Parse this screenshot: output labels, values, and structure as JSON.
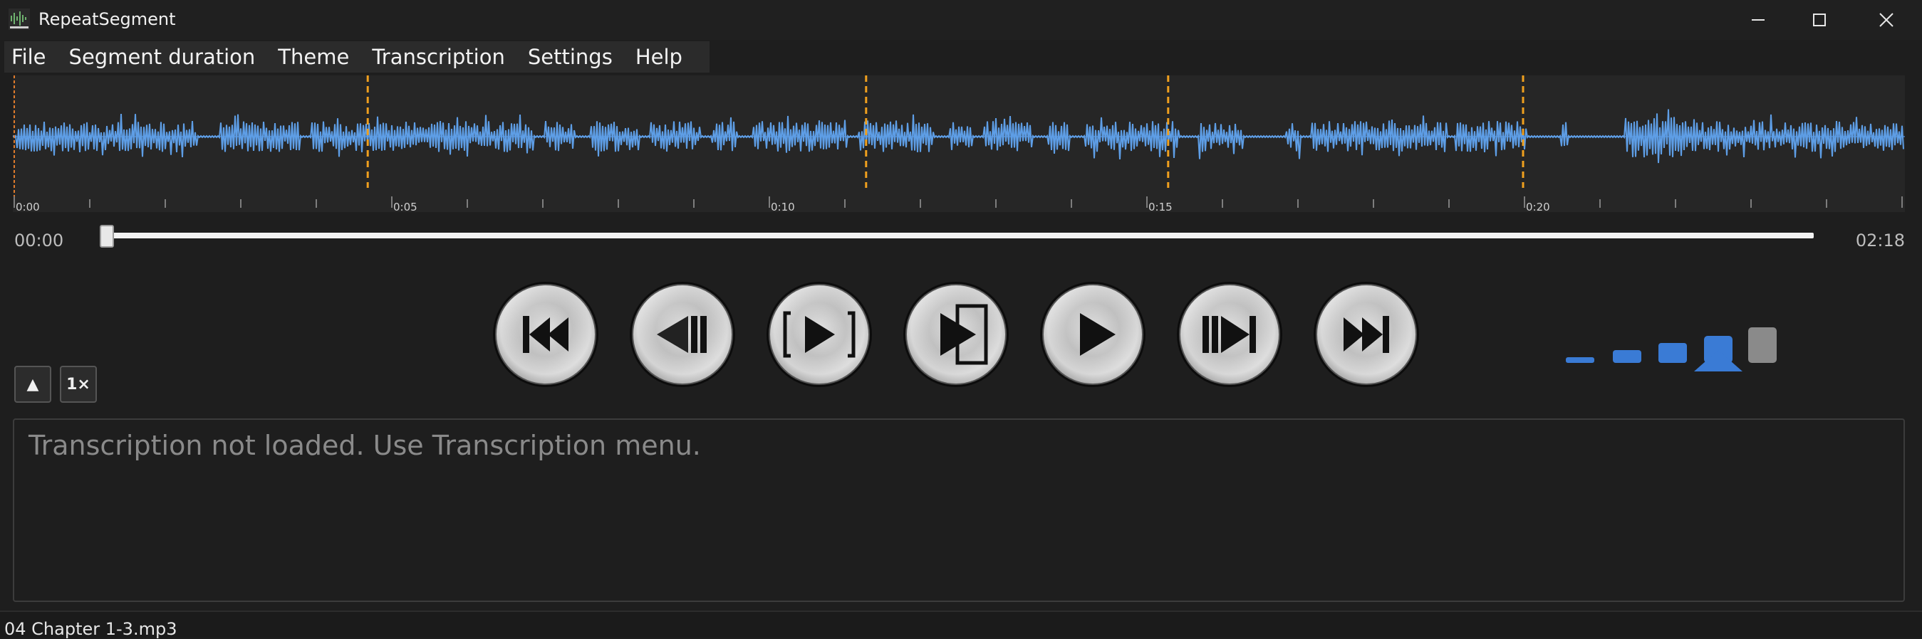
{
  "window": {
    "title": "RepeatSegment",
    "icon": "app-waveform-icon",
    "controls": [
      "minimize-icon",
      "maximize-icon",
      "close-icon"
    ]
  },
  "menu": {
    "items": [
      "File",
      "Segment duration",
      "Theme",
      "Transcription",
      "Settings",
      "Help"
    ]
  },
  "waveform": {
    "tick_labels": [
      "0:00",
      "0:05",
      "0:10",
      "0:15",
      "0:20"
    ],
    "segment_markers_seconds": [
      4.7,
      11.3,
      15.3,
      20.0
    ],
    "visible_duration_seconds": 25,
    "colors": {
      "wave": "#5e9ee6",
      "marker": "#f0a01e",
      "playhead": "#e07a2a",
      "background": "#262626"
    }
  },
  "seek": {
    "current_time": "00:00",
    "total_time": "02:18",
    "position_fraction": 0.0
  },
  "transport": {
    "buttons": [
      {
        "name": "go-to-start-icon"
      },
      {
        "name": "previous-segment-icon"
      },
      {
        "name": "repeat-segment-icon"
      },
      {
        "name": "play-to-segment-end-icon"
      },
      {
        "name": "play-icon"
      },
      {
        "name": "next-segment-icon"
      },
      {
        "name": "go-to-end-icon"
      }
    ]
  },
  "controls": {
    "collapse_symbol": "▲",
    "speed_label": "1×",
    "segment_size_icons": [
      "size-xs-icon",
      "size-s-icon",
      "size-m-icon",
      "size-l-icon",
      "size-xl-icon"
    ],
    "accent": "#3a7bd5"
  },
  "transcription": {
    "placeholder": "Transcription not loaded. Use Transcription menu."
  },
  "status": {
    "filename": "04 Chapter 1-3.mp3"
  }
}
